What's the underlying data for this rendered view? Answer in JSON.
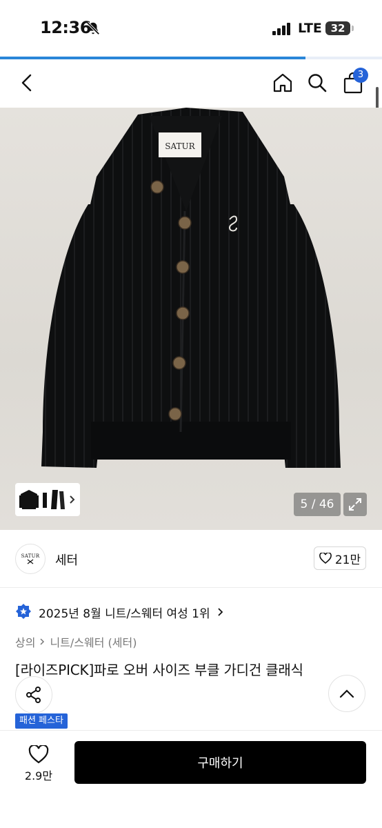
{
  "status_bar": {
    "time": "12:36",
    "network": "LTE",
    "battery": "32"
  },
  "page_load": {
    "progress": 0.8
  },
  "nav": {
    "cart_count": "3"
  },
  "gallery": {
    "counter": "5 / 46",
    "garment_label_text": "SATUR",
    "colors": {
      "garment": "#0e0f10",
      "button": "#7a6448"
    }
  },
  "brand": {
    "logo_text": "SATUR",
    "name": "세터",
    "like_count": "21만"
  },
  "ranking": {
    "text": "2025년 8월 니트/스웨터 여성 1위"
  },
  "breadcrumb": {
    "level1": "상의",
    "level2": "니트/스웨터 (세터)"
  },
  "product": {
    "title": "[라이즈PICK]파로 오버 사이즈 부클 가디건 클래식"
  },
  "event_tag": "패션 페스타",
  "bottom_bar": {
    "wish_count": "2.9만",
    "buy_label": "구매하기"
  },
  "accent_color": "#2563d8"
}
